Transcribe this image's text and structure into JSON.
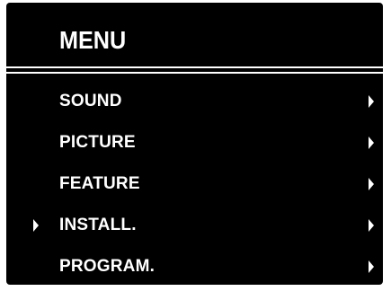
{
  "menu": {
    "title": "MENU",
    "selected_index": 3,
    "items": [
      {
        "label": "SOUND",
        "icon": "chevron-right-icon"
      },
      {
        "label": "PICTURE",
        "icon": "chevron-right-icon"
      },
      {
        "label": "FEATURE",
        "icon": "chevron-right-icon"
      },
      {
        "label": "INSTALL.",
        "icon": "chevron-right-icon"
      },
      {
        "label": "PROGRAM.",
        "icon": "chevron-right-icon"
      }
    ]
  },
  "colors": {
    "background": "#000000",
    "text": "#ffffff"
  }
}
